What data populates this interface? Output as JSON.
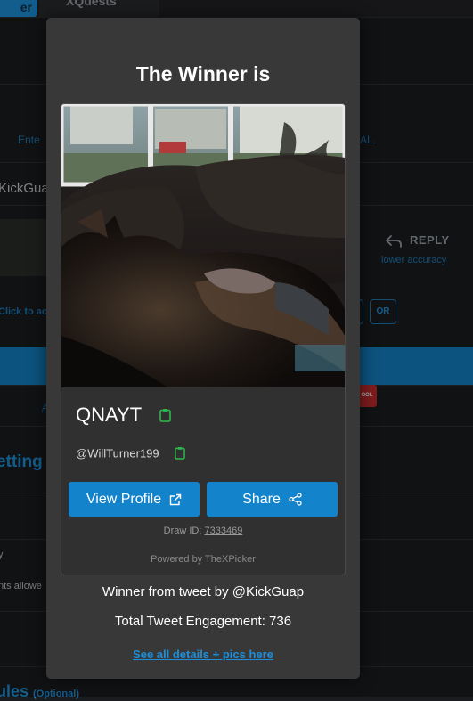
{
  "background": {
    "tabs": [
      {
        "label": "er",
        "active": true
      },
      {
        "label": "XQuests",
        "active": false
      }
    ],
    "enter_left": "Ente",
    "enter_right": "AL.",
    "username_stub": "KickGua",
    "reply_label": "REPLY",
    "reply_sub": "lower accuracy",
    "click_to": "Click to ac",
    "or_label": "OR",
    "small_link": "A",
    "tool_badge": "OOL",
    "settings_heading": "etting",
    "y_stub": "y",
    "allowed_stub": "nts allowe",
    "rules_heading": "ules",
    "rules_optional": "(Optional)"
  },
  "modal": {
    "title": "The Winner is",
    "winner_name": "QNAYT",
    "winner_handle": "@WillTurner199",
    "view_profile_label": "View Profile",
    "share_label": "Share",
    "draw_id_label": "Draw ID:",
    "draw_id_value": "7333469",
    "powered_by": "Powered by TheXPicker",
    "from_tweet": "Winner from tweet by @KickGuap",
    "engagement": "Total Tweet Engagement: 736",
    "details_link": "See all details + pics here"
  },
  "colors": {
    "accent": "#1383cb",
    "link": "#1e8fd8",
    "modal_bg": "#383838",
    "clipboard_icon": "#2fb84a"
  },
  "icons": [
    "reply-arrow-icon",
    "clipboard-icon",
    "external-link-icon",
    "share-icon"
  ]
}
